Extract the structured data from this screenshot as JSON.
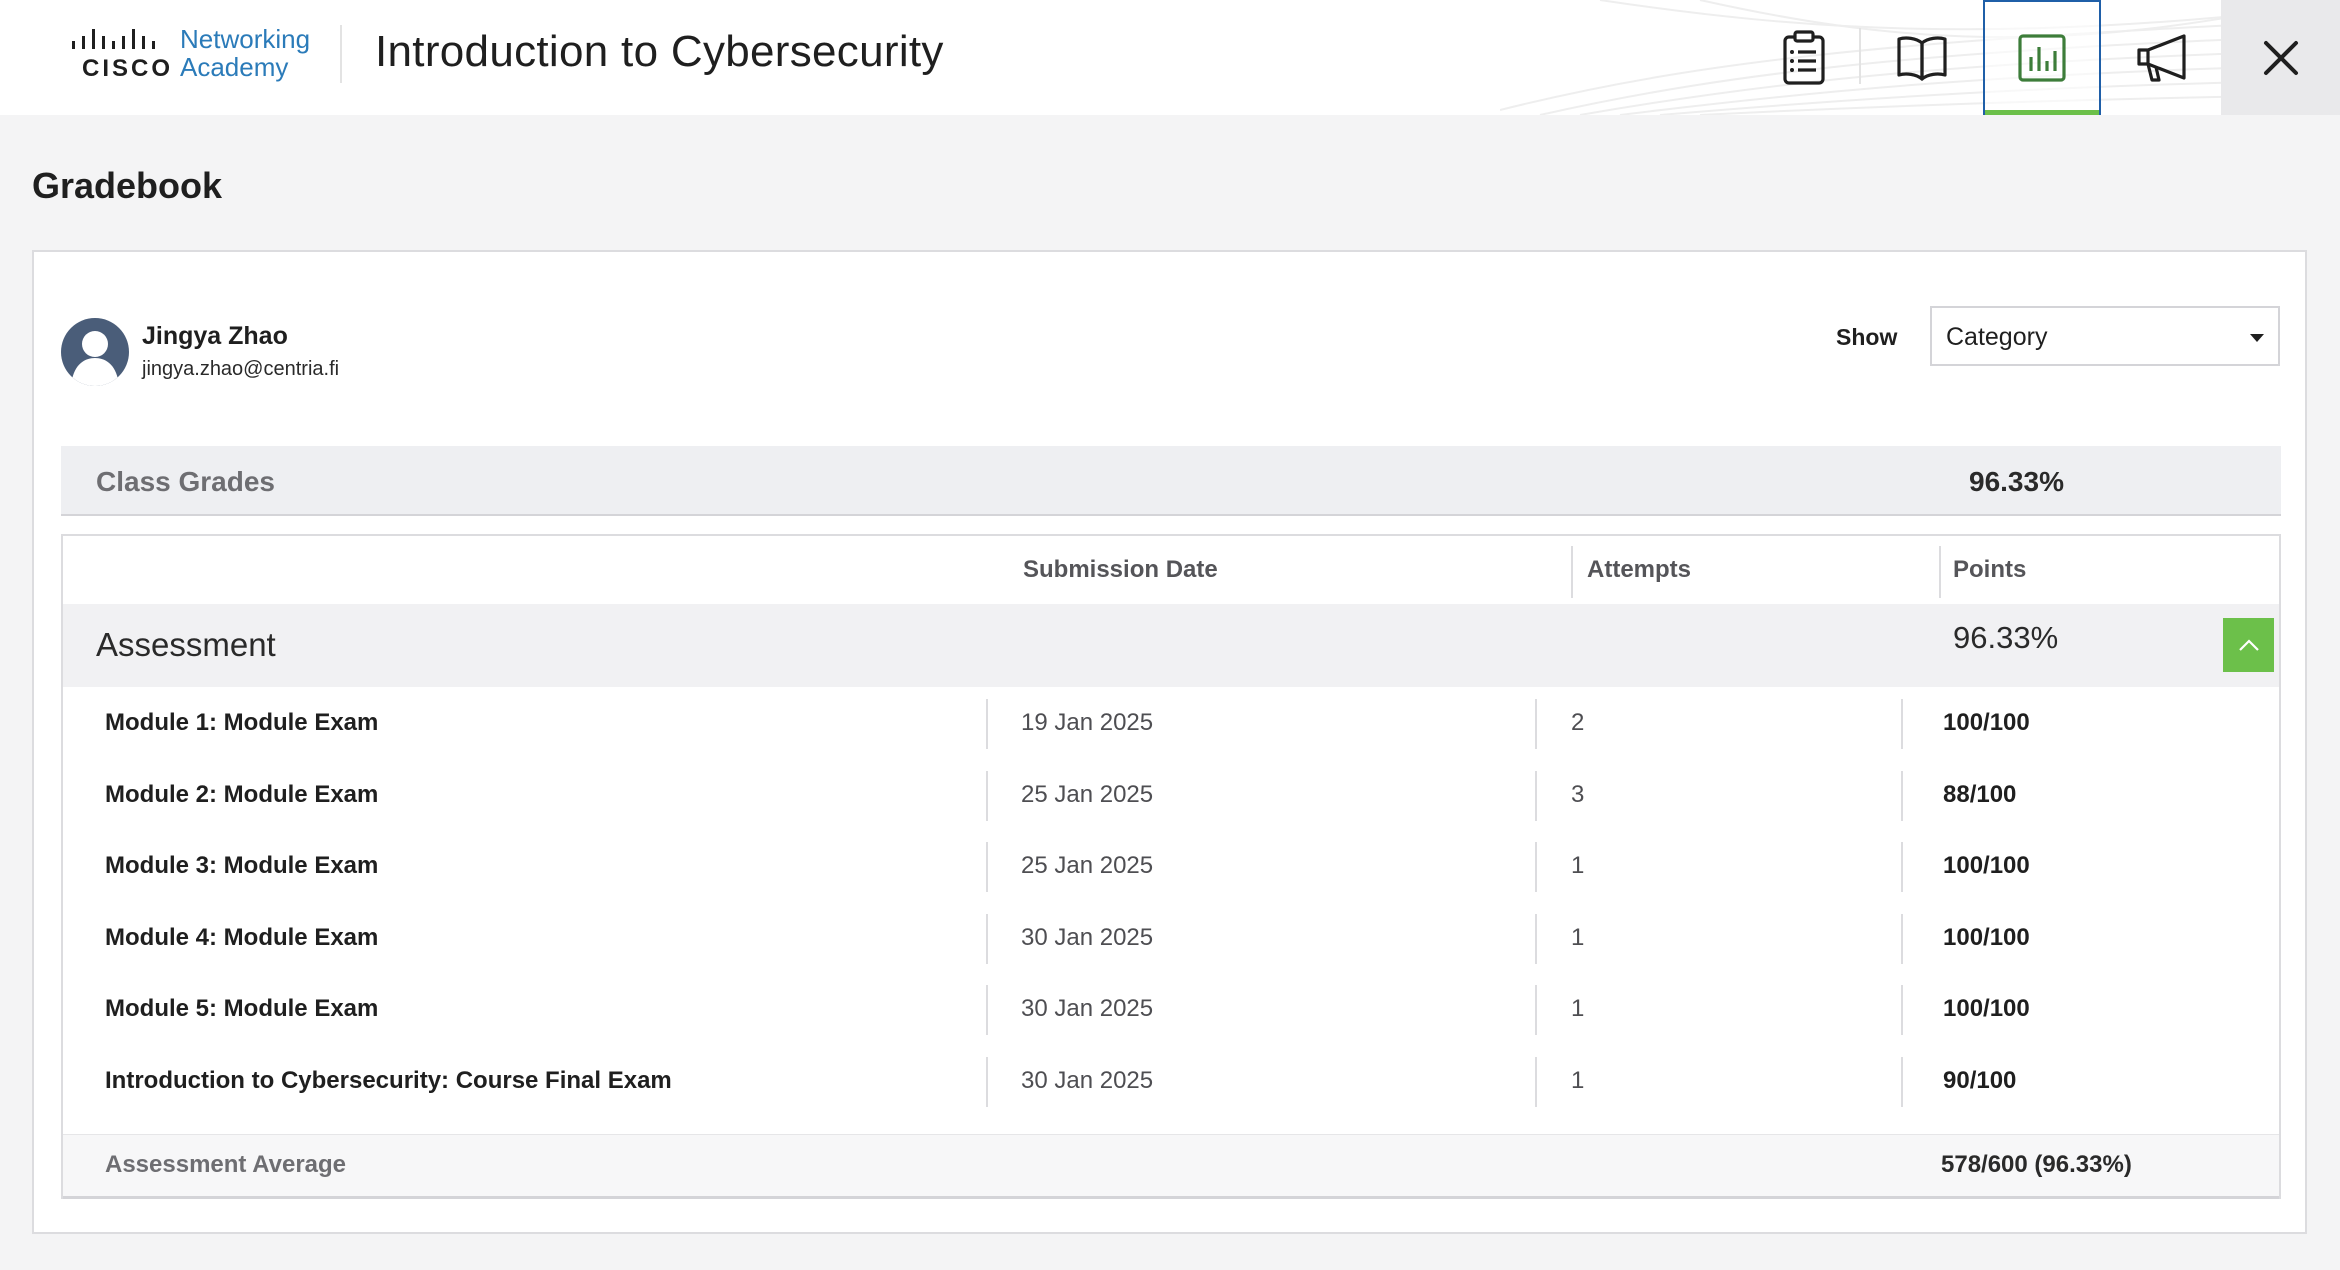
{
  "header": {
    "logo_word": "CISCO",
    "logo_line1": "Networking",
    "logo_line2": "Academy",
    "course_title": "Introduction to Cybersecurity",
    "nav_icons": [
      "clipboard-list-icon",
      "book-icon",
      "bar-chart-icon",
      "megaphone-icon"
    ],
    "active_nav": "bar-chart-icon",
    "close_icon": "close-icon"
  },
  "page": {
    "title": "Gradebook"
  },
  "user": {
    "name": "Jingya Zhao",
    "email": "jingya.zhao@centria.fi"
  },
  "filter": {
    "label": "Show",
    "selected": "Category"
  },
  "class_grades": {
    "label": "Class Grades",
    "value": "96.33%"
  },
  "table": {
    "headers": {
      "submission_date": "Submission Date",
      "attempts": "Attempts",
      "points": "Points"
    },
    "category": {
      "label": "Assessment",
      "value": "96.33%"
    },
    "rows": [
      {
        "name": "Module 1: Module Exam",
        "date": "19 Jan 2025",
        "attempts": "2",
        "points": "100/100"
      },
      {
        "name": "Module 2: Module Exam",
        "date": "25 Jan 2025",
        "attempts": "3",
        "points": "88/100"
      },
      {
        "name": "Module 3: Module Exam",
        "date": "25 Jan 2025",
        "attempts": "1",
        "points": "100/100"
      },
      {
        "name": "Module 4: Module Exam",
        "date": "30 Jan 2025",
        "attempts": "1",
        "points": "100/100"
      },
      {
        "name": "Module 5: Module Exam",
        "date": "30 Jan 2025",
        "attempts": "1",
        "points": "100/100"
      },
      {
        "name": "Introduction to Cybersecurity: Course Final Exam",
        "date": "30 Jan 2025",
        "attempts": "1",
        "points": "90/100"
      }
    ],
    "average": {
      "label": "Assessment Average",
      "value": "578/600 (96.33%)"
    }
  },
  "colors": {
    "accent_green": "#6cc04a",
    "active_border_blue": "#1f5fa8",
    "cisco_blue": "#2b7bb9"
  }
}
